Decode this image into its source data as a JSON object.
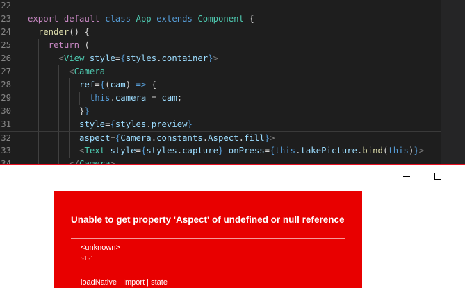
{
  "editor": {
    "lines": [
      {
        "num": "22",
        "tokens": []
      },
      {
        "num": "23",
        "tokens": [
          {
            "t": "export",
            "c": "kw"
          },
          {
            "t": " ",
            "c": "pn"
          },
          {
            "t": "default",
            "c": "kw"
          },
          {
            "t": " ",
            "c": "pn"
          },
          {
            "t": "class",
            "c": "sk"
          },
          {
            "t": " ",
            "c": "pn"
          },
          {
            "t": "App",
            "c": "cls"
          },
          {
            "t": " ",
            "c": "pn"
          },
          {
            "t": "extends",
            "c": "sk"
          },
          {
            "t": " ",
            "c": "pn"
          },
          {
            "t": "Component",
            "c": "cls"
          },
          {
            "t": " {",
            "c": "pn"
          }
        ]
      },
      {
        "num": "24",
        "tokens": [
          {
            "t": "  ",
            "c": "lead"
          },
          {
            "t": "render",
            "c": "fn"
          },
          {
            "t": "() {",
            "c": "pn"
          }
        ]
      },
      {
        "num": "25",
        "tokens": [
          {
            "t": "    ",
            "c": "lead"
          },
          {
            "t": "return",
            "c": "kw"
          },
          {
            "t": " (",
            "c": "pn"
          }
        ]
      },
      {
        "num": "26",
        "tokens": [
          {
            "t": "      ",
            "c": "lead"
          },
          {
            "t": "<",
            "c": "brk"
          },
          {
            "t": "View",
            "c": "tag"
          },
          {
            "t": " ",
            "c": "pn"
          },
          {
            "t": "style",
            "c": "attr"
          },
          {
            "t": "=",
            "c": "pn"
          },
          {
            "t": "{",
            "c": "sk"
          },
          {
            "t": "styles",
            "c": "var"
          },
          {
            "t": ".",
            "c": "pn"
          },
          {
            "t": "container",
            "c": "var"
          },
          {
            "t": "}",
            "c": "sk"
          },
          {
            "t": ">",
            "c": "brk"
          }
        ]
      },
      {
        "num": "27",
        "tokens": [
          {
            "t": "        ",
            "c": "lead"
          },
          {
            "t": "<",
            "c": "brk"
          },
          {
            "t": "Camera",
            "c": "tag"
          }
        ]
      },
      {
        "num": "28",
        "tokens": [
          {
            "t": "          ",
            "c": "lead"
          },
          {
            "t": "ref",
            "c": "attr"
          },
          {
            "t": "=",
            "c": "pn"
          },
          {
            "t": "{",
            "c": "sk"
          },
          {
            "t": "(",
            "c": "pn"
          },
          {
            "t": "cam",
            "c": "var"
          },
          {
            "t": ") ",
            "c": "pn"
          },
          {
            "t": "=>",
            "c": "sk"
          },
          {
            "t": " {",
            "c": "pn"
          }
        ]
      },
      {
        "num": "29",
        "tokens": [
          {
            "t": "            ",
            "c": "lead"
          },
          {
            "t": "this",
            "c": "sk"
          },
          {
            "t": ".",
            "c": "pn"
          },
          {
            "t": "camera",
            "c": "var"
          },
          {
            "t": " = ",
            "c": "pn"
          },
          {
            "t": "cam",
            "c": "var"
          },
          {
            "t": ";",
            "c": "pn"
          }
        ]
      },
      {
        "num": "30",
        "tokens": [
          {
            "t": "          ",
            "c": "lead"
          },
          {
            "t": "}",
            "c": "pn"
          },
          {
            "t": "}",
            "c": "sk"
          }
        ]
      },
      {
        "num": "31",
        "tokens": [
          {
            "t": "          ",
            "c": "lead"
          },
          {
            "t": "style",
            "c": "attr"
          },
          {
            "t": "=",
            "c": "pn"
          },
          {
            "t": "{",
            "c": "sk"
          },
          {
            "t": "styles",
            "c": "var"
          },
          {
            "t": ".",
            "c": "pn"
          },
          {
            "t": "preview",
            "c": "var"
          },
          {
            "t": "}",
            "c": "sk"
          }
        ]
      },
      {
        "num": "32",
        "tokens": [
          {
            "t": "          ",
            "c": "lead"
          },
          {
            "t": "aspect",
            "c": "attr"
          },
          {
            "t": "=",
            "c": "pn"
          },
          {
            "t": "{",
            "c": "sk"
          },
          {
            "t": "Camera",
            "c": "var"
          },
          {
            "t": ".",
            "c": "pn"
          },
          {
            "t": "constants",
            "c": "var"
          },
          {
            "t": ".",
            "c": "pn"
          },
          {
            "t": "Aspect",
            "c": "var"
          },
          {
            "t": ".",
            "c": "pn"
          },
          {
            "t": "fill",
            "c": "var"
          },
          {
            "t": "}",
            "c": "sk"
          },
          {
            "t": ">",
            "c": "brk"
          }
        ]
      },
      {
        "num": "33",
        "tokens": [
          {
            "t": "          ",
            "c": "lead"
          },
          {
            "t": "<",
            "c": "brk"
          },
          {
            "t": "Text",
            "c": "tag"
          },
          {
            "t": " ",
            "c": "pn"
          },
          {
            "t": "style",
            "c": "attr"
          },
          {
            "t": "=",
            "c": "pn"
          },
          {
            "t": "{",
            "c": "sk"
          },
          {
            "t": "styles",
            "c": "var"
          },
          {
            "t": ".",
            "c": "pn"
          },
          {
            "t": "capture",
            "c": "var"
          },
          {
            "t": "}",
            "c": "sk"
          },
          {
            "t": " ",
            "c": "pn"
          },
          {
            "t": "onPress",
            "c": "attr"
          },
          {
            "t": "=",
            "c": "pn"
          },
          {
            "t": "{",
            "c": "sk"
          },
          {
            "t": "this",
            "c": "sk"
          },
          {
            "t": ".",
            "c": "pn"
          },
          {
            "t": "takePicture",
            "c": "var"
          },
          {
            "t": ".",
            "c": "pn"
          },
          {
            "t": "bind",
            "c": "fn"
          },
          {
            "t": "(",
            "c": "pn"
          },
          {
            "t": "this",
            "c": "sk"
          },
          {
            "t": ")",
            "c": "pn"
          },
          {
            "t": "}",
            "c": "sk"
          },
          {
            "t": ">",
            "c": "brk"
          }
        ]
      },
      {
        "num": "34",
        "tokens": [
          {
            "t": "        ",
            "c": "lead"
          },
          {
            "t": "</",
            "c": "brk"
          },
          {
            "t": "Camera",
            "c": "tag"
          },
          {
            "t": ">",
            "c": "brk"
          }
        ]
      }
    ]
  },
  "window": {
    "minimize_icon": "minimize-icon",
    "maximize_icon": "maximize-icon"
  },
  "error": {
    "message": "Unable to get property 'Aspect' of undefined or null reference",
    "frames": [
      {
        "name": "<unknown>",
        "location": ":-1:-1"
      },
      {
        "name": "loadNative | Import | state",
        "location": ""
      }
    ]
  },
  "colors": {
    "editor_bg": "#1e1e1e",
    "error_bg": "#e80000",
    "divider": "#e81123"
  }
}
